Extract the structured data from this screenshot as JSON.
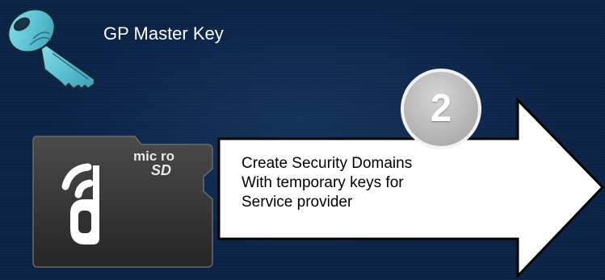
{
  "key": {
    "label": "GP Master Key",
    "icon": "key-icon",
    "color": "#62c9d8"
  },
  "card": {
    "logo_text": "micro SD",
    "icon": "microsd-card-icon",
    "color": "#3a3a3a"
  },
  "step": {
    "number": "2",
    "text_lines": [
      "Create Security Domains",
      "With temporary keys for",
      "Service provider"
    ]
  },
  "colors": {
    "background": "#0a2346",
    "arrow_fill": "#ffffff",
    "arrow_outline": "#000000",
    "badge": "#bcbcbc"
  }
}
